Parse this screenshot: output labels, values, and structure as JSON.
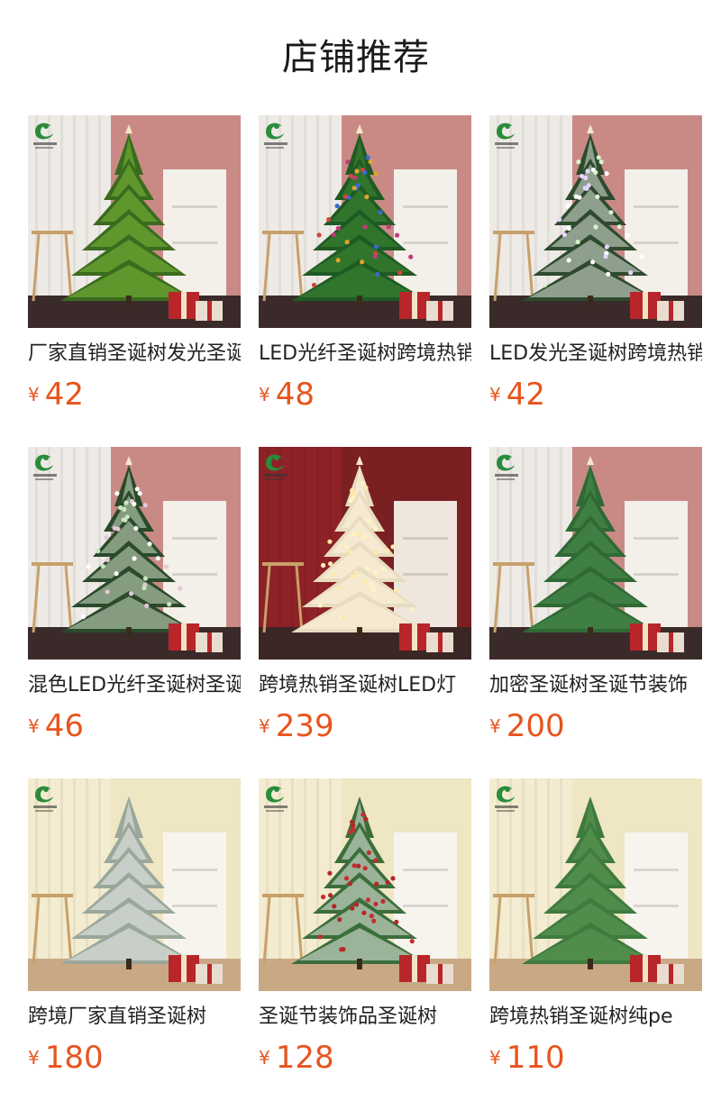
{
  "section": {
    "title": "店铺推荐"
  },
  "products": [
    {
      "name": "厂家直销圣诞树发光圣诞树",
      "currency": "¥",
      "price": "42",
      "scene": "red-room",
      "tree": "fiber-green"
    },
    {
      "name": "LED光纤圣诞树跨境热销",
      "currency": "¥",
      "price": "48",
      "scene": "red-room",
      "tree": "fiber-colorful"
    },
    {
      "name": "LED发光圣诞树跨境热销",
      "currency": "¥",
      "price": "42",
      "scene": "red-room",
      "tree": "fiber-white"
    },
    {
      "name": "混色LED光纤圣诞树圣诞",
      "currency": "¥",
      "price": "46",
      "scene": "red-room",
      "tree": "fiber-mixed"
    },
    {
      "name": "跨境热销圣诞树LED灯",
      "currency": "¥",
      "price": "239",
      "scene": "dark-red-room",
      "tree": "white-lit"
    },
    {
      "name": "加密圣诞树圣诞节装饰",
      "currency": "¥",
      "price": "200",
      "scene": "red-room",
      "tree": "pine-green"
    },
    {
      "name": "跨境厂家直销圣诞树",
      "currency": "¥",
      "price": "180",
      "scene": "cream-room",
      "tree": "flocked"
    },
    {
      "name": "圣诞节装饰品圣诞树",
      "currency": "¥",
      "price": "128",
      "scene": "cream-room",
      "tree": "red-berry"
    },
    {
      "name": "跨境热销圣诞树纯pe",
      "currency": "¥",
      "price": "110",
      "scene": "cream-room",
      "tree": "pe-green"
    }
  ],
  "colors": {
    "price": "#e8541e",
    "brand_logo": "#2a8c3a"
  }
}
